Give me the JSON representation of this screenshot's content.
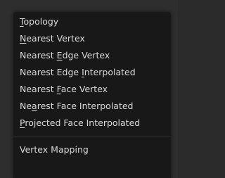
{
  "menu": {
    "items": [
      {
        "pre": "",
        "key": "T",
        "post": "opology"
      },
      {
        "pre": "",
        "key": "N",
        "post": "earest Vertex"
      },
      {
        "pre": "Nearest ",
        "key": "E",
        "post": "dge Vertex"
      },
      {
        "pre": "Nearest Edge ",
        "key": "I",
        "post": "nterpolated"
      },
      {
        "pre": "Nearest ",
        "key": "F",
        "post": "ace Vertex"
      },
      {
        "pre": "Ne",
        "key": "a",
        "post": "rest Face Interpolated"
      },
      {
        "pre": "",
        "key": "P",
        "post": "rojected Face Interpolated"
      }
    ],
    "footer_item": {
      "pre": "Vertex Mapping",
      "key": "",
      "post": ""
    }
  },
  "colors": {
    "menu_bg": "#181818",
    "text": "#d9d9d9",
    "separator": "#2f2f2f"
  }
}
